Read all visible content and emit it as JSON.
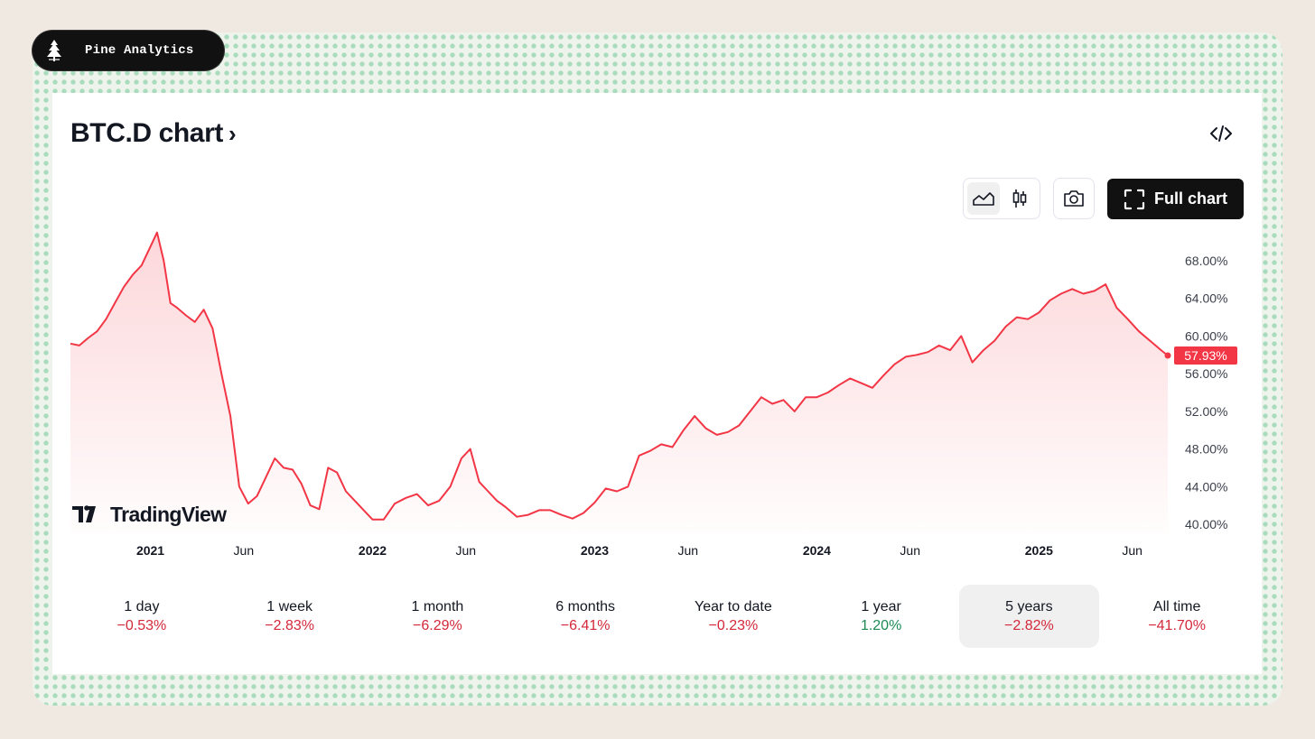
{
  "brand": {
    "name": "Pine Analytics",
    "logo_icon": "pine-tree-icon"
  },
  "header": {
    "title": "BTC.D chart",
    "title_chevron": "›",
    "embed_icon": "code-icon"
  },
  "toolbar": {
    "area_icon": "area-chart-icon",
    "candles_icon": "candlestick-icon",
    "camera_icon": "camera-icon",
    "full_chart_label": "Full chart",
    "full_chart_icon": "fullscreen-icon"
  },
  "colors": {
    "line": "#f23645",
    "negative": "#d3283a",
    "positive": "#1c8a55",
    "badge": "#f23645"
  },
  "watermark": "TradingView",
  "chart_data": {
    "type": "area",
    "title": "BTC.D",
    "y_ticks": [
      "68.00%",
      "64.00%",
      "60.00%",
      "56.00%",
      "52.00%",
      "48.00%",
      "44.00%",
      "40.00%"
    ],
    "y_range": [
      40,
      68
    ],
    "x_ticks": [
      {
        "label": "2021",
        "t": 2021.0,
        "bold": true
      },
      {
        "label": "Jun",
        "t": 2021.42,
        "bold": false
      },
      {
        "label": "2022",
        "t": 2022.0,
        "bold": true
      },
      {
        "label": "Jun",
        "t": 2022.42,
        "bold": false
      },
      {
        "label": "2023",
        "t": 2023.0,
        "bold": true
      },
      {
        "label": "Jun",
        "t": 2023.42,
        "bold": false
      },
      {
        "label": "2024",
        "t": 2024.0,
        "bold": true
      },
      {
        "label": "Jun",
        "t": 2024.42,
        "bold": false
      },
      {
        "label": "2025",
        "t": 2025.0,
        "bold": true
      },
      {
        "label": "Jun",
        "t": 2025.42,
        "bold": false
      }
    ],
    "last_value_label": "57.93%",
    "series": [
      {
        "t": [
          2020.64,
          2020.68,
          2020.72,
          2020.76,
          2020.8,
          2020.84,
          2020.88,
          2020.92,
          2020.96,
          2021.0,
          2021.03,
          2021.06,
          2021.09,
          2021.12,
          2021.16,
          2021.2,
          2021.24,
          2021.28,
          2021.32,
          2021.36,
          2021.4,
          2021.44,
          2021.48,
          2021.52,
          2021.56,
          2021.6,
          2021.64,
          2021.68,
          2021.72,
          2021.76,
          2021.8,
          2021.84,
          2021.88,
          2021.92,
          2021.96,
          2022.0,
          2022.05,
          2022.1,
          2022.15,
          2022.2,
          2022.25,
          2022.3,
          2022.35,
          2022.4,
          2022.44,
          2022.48,
          2022.52,
          2022.56,
          2022.6,
          2022.65,
          2022.7,
          2022.75,
          2022.8,
          2022.85,
          2022.9,
          2022.95,
          2023.0,
          2023.05,
          2023.1,
          2023.15,
          2023.2,
          2023.25,
          2023.3,
          2023.35,
          2023.4,
          2023.45,
          2023.5,
          2023.55,
          2023.6,
          2023.65,
          2023.7,
          2023.75,
          2023.8,
          2023.85,
          2023.9,
          2023.95,
          2024.0,
          2024.05,
          2024.1,
          2024.15,
          2024.2,
          2024.25,
          2024.3,
          2024.35,
          2024.4,
          2024.45,
          2024.5,
          2024.55,
          2024.6,
          2024.65,
          2024.7,
          2024.75,
          2024.8,
          2024.85,
          2024.9,
          2024.95,
          2025.0,
          2025.05,
          2025.1,
          2025.15,
          2025.2,
          2025.25,
          2025.3,
          2025.35,
          2025.4,
          2025.45,
          2025.5,
          2025.55,
          2025.58
        ],
        "v": [
          59.2,
          59.0,
          59.8,
          60.5,
          61.8,
          63.5,
          65.2,
          66.5,
          67.5,
          69.5,
          71.0,
          68.0,
          63.5,
          63.0,
          62.2,
          61.5,
          62.8,
          60.8,
          56.0,
          51.5,
          44.0,
          42.2,
          43.0,
          45.0,
          47.0,
          46.0,
          45.8,
          44.3,
          42.0,
          41.6,
          46.0,
          45.5,
          43.5,
          42.5,
          41.5,
          40.5,
          40.5,
          42.2,
          42.8,
          43.2,
          42.0,
          42.5,
          44.0,
          47.0,
          48.0,
          44.5,
          43.5,
          42.5,
          41.8,
          40.8,
          41.0,
          41.5,
          41.5,
          41.0,
          40.6,
          41.2,
          42.3,
          43.8,
          43.5,
          44.0,
          47.3,
          47.8,
          48.5,
          48.2,
          50.0,
          51.5,
          50.2,
          49.5,
          49.8,
          50.5,
          52.0,
          53.5,
          52.8,
          53.2,
          52.0,
          53.5,
          53.5,
          54.0,
          54.8,
          55.5,
          55.0,
          54.5,
          55.8,
          57.0,
          57.8,
          58.0,
          58.3,
          59.0,
          58.5,
          60.0,
          57.2,
          58.5,
          59.5,
          61.0,
          62.0,
          61.8,
          62.5,
          63.8,
          64.5,
          65.0,
          64.5,
          64.8,
          65.5,
          63.0,
          61.8,
          60.5,
          59.5,
          58.5,
          57.93
        ]
      }
    ],
    "grid": false,
    "scale": "linear"
  },
  "periods": [
    {
      "label": "1 day",
      "value": "−0.53%",
      "sign": "neg",
      "selected": false
    },
    {
      "label": "1 week",
      "value": "−2.83%",
      "sign": "neg",
      "selected": false
    },
    {
      "label": "1 month",
      "value": "−6.29%",
      "sign": "neg",
      "selected": false
    },
    {
      "label": "6 months",
      "value": "−6.41%",
      "sign": "neg",
      "selected": false
    },
    {
      "label": "Year to date",
      "value": "−0.23%",
      "sign": "neg",
      "selected": false
    },
    {
      "label": "1 year",
      "value": "1.20%",
      "sign": "pos",
      "selected": false
    },
    {
      "label": "5 years",
      "value": "−2.82%",
      "sign": "neg",
      "selected": true
    },
    {
      "label": "All time",
      "value": "−41.70%",
      "sign": "neg",
      "selected": false
    }
  ]
}
